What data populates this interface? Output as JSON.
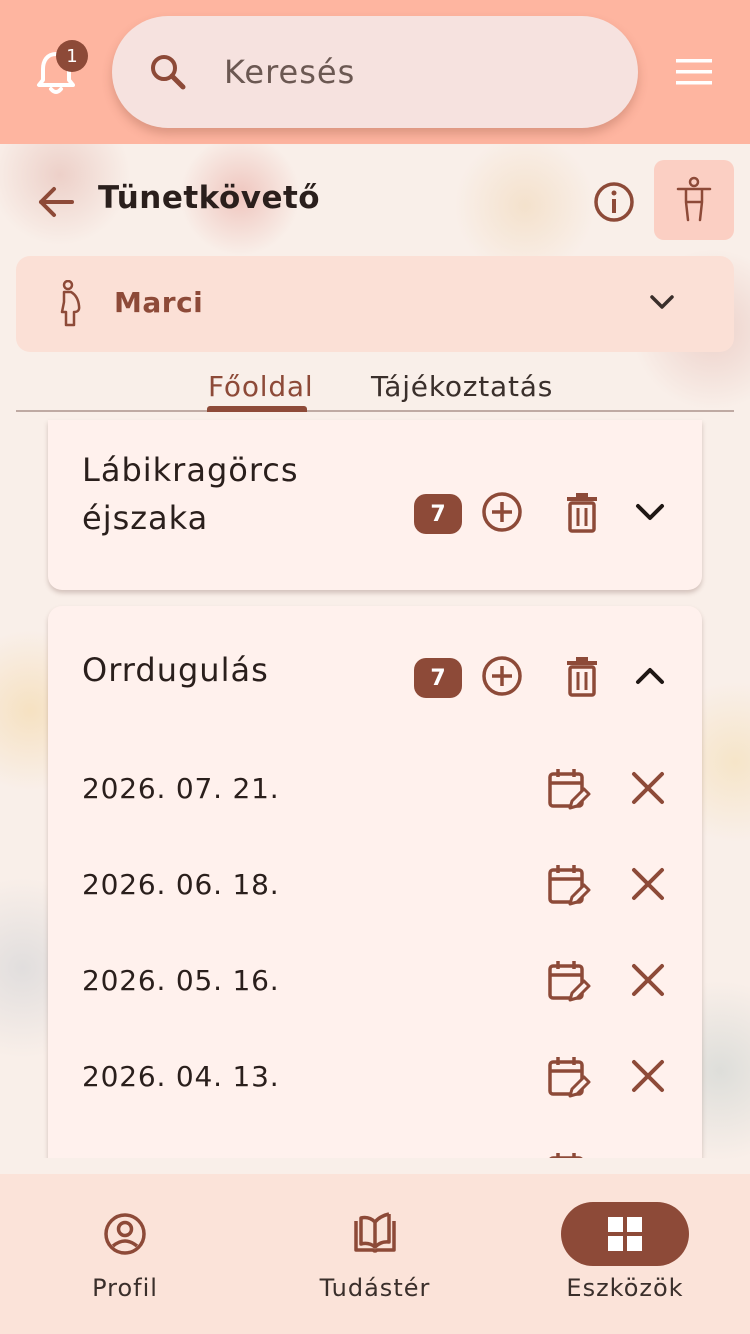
{
  "header": {
    "notification_count": "1",
    "search_placeholder": "Keresés",
    "icons": {
      "bell": "bell-icon",
      "search": "search-icon",
      "menu": "menu-icon"
    }
  },
  "page": {
    "title": "Tünetkövető",
    "icons": {
      "back": "arrow-left-icon",
      "info": "info-icon",
      "accessibility": "accessibility-icon"
    }
  },
  "selector": {
    "name": "Marci",
    "icon": "pregnant-woman-icon"
  },
  "tabs": [
    {
      "label": "Főoldal",
      "active": true
    },
    {
      "label": "Tájékoztatás",
      "active": false
    }
  ],
  "symptoms": [
    {
      "title": "Lábikragörcs éjszaka",
      "count": "7",
      "expanded": false
    },
    {
      "title": "Orrdugulás",
      "count": "7",
      "expanded": true,
      "entries": [
        {
          "date": "2026. 07. 21."
        },
        {
          "date": "2026. 06. 18."
        },
        {
          "date": "2026. 05. 16."
        },
        {
          "date": "2026. 04. 13."
        }
      ]
    }
  ],
  "bottom_nav": [
    {
      "label": "Profil",
      "icon": "account-circle-icon",
      "active": false
    },
    {
      "label": "Tudástér",
      "icon": "book-open-icon",
      "active": false
    },
    {
      "label": "Eszközök",
      "icon": "grid-icon",
      "active": true
    }
  ],
  "colors": {
    "header": "#feb5a0",
    "accent": "#8d4a38",
    "card": "#fff1ed",
    "selector": "#fbe0d6"
  }
}
